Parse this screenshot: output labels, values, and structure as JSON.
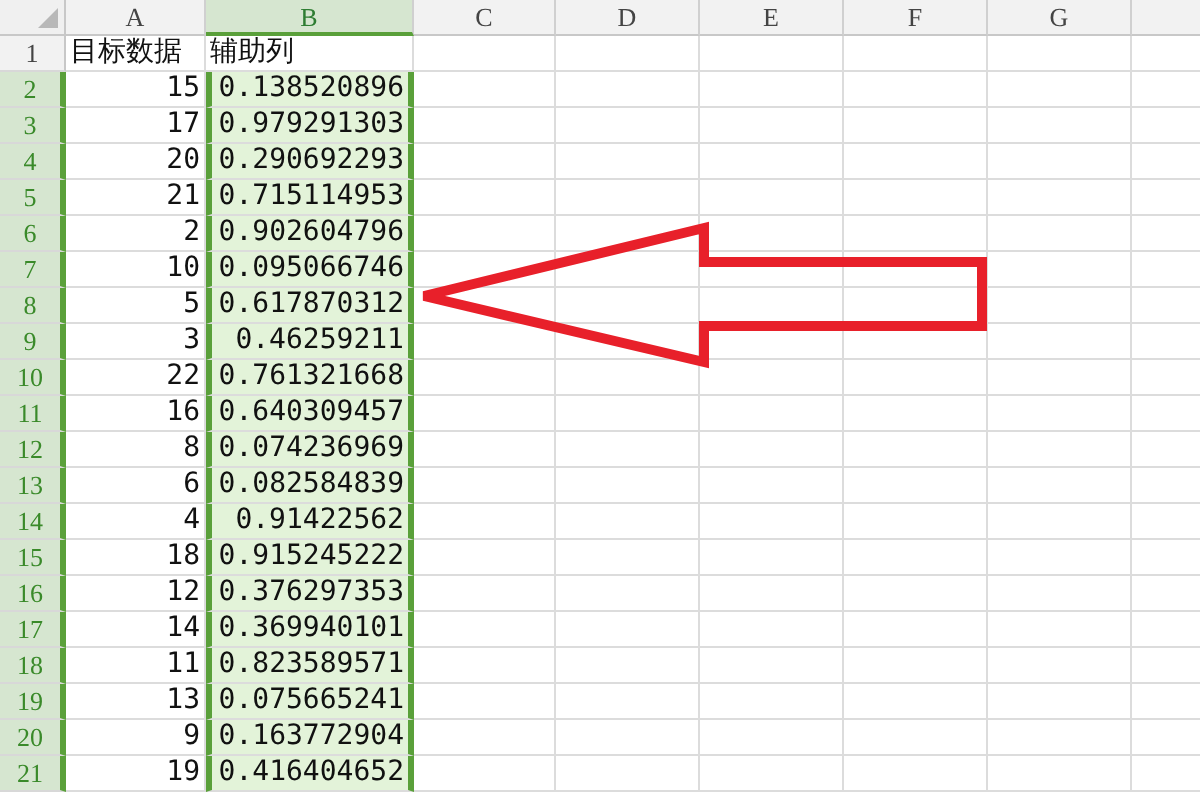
{
  "columns": [
    {
      "label": "A",
      "selected": false
    },
    {
      "label": "B",
      "selected": true
    },
    {
      "label": "C",
      "selected": false
    },
    {
      "label": "D",
      "selected": false
    },
    {
      "label": "E",
      "selected": false
    },
    {
      "label": "F",
      "selected": false
    },
    {
      "label": "G",
      "selected": false
    }
  ],
  "rows": [
    {
      "number": "1",
      "selected": false,
      "kind": "text",
      "cells": [
        "目标数据",
        "辅助列"
      ]
    },
    {
      "number": "2",
      "selected": true,
      "kind": "number",
      "cells": [
        "15",
        "0.138520896"
      ]
    },
    {
      "number": "3",
      "selected": true,
      "kind": "number",
      "cells": [
        "17",
        "0.979291303"
      ]
    },
    {
      "number": "4",
      "selected": true,
      "kind": "number",
      "cells": [
        "20",
        "0.290692293"
      ]
    },
    {
      "number": "5",
      "selected": true,
      "kind": "number",
      "cells": [
        "21",
        "0.715114953"
      ]
    },
    {
      "number": "6",
      "selected": true,
      "kind": "number",
      "cells": [
        "2",
        "0.902604796"
      ]
    },
    {
      "number": "7",
      "selected": true,
      "kind": "number",
      "cells": [
        "10",
        "0.095066746"
      ]
    },
    {
      "number": "8",
      "selected": true,
      "kind": "number",
      "cells": [
        "5",
        "0.617870312"
      ]
    },
    {
      "number": "9",
      "selected": true,
      "kind": "number",
      "cells": [
        "3",
        "0.46259211"
      ]
    },
    {
      "number": "10",
      "selected": true,
      "kind": "number",
      "cells": [
        "22",
        "0.761321668"
      ]
    },
    {
      "number": "11",
      "selected": true,
      "kind": "number",
      "cells": [
        "16",
        "0.640309457"
      ]
    },
    {
      "number": "12",
      "selected": true,
      "kind": "number",
      "cells": [
        "8",
        "0.074236969"
      ]
    },
    {
      "number": "13",
      "selected": true,
      "kind": "number",
      "cells": [
        "6",
        "0.082584839"
      ]
    },
    {
      "number": "14",
      "selected": true,
      "kind": "number",
      "cells": [
        "4",
        "0.91422562"
      ]
    },
    {
      "number": "15",
      "selected": true,
      "kind": "number",
      "cells": [
        "18",
        "0.915245222"
      ]
    },
    {
      "number": "16",
      "selected": true,
      "kind": "number",
      "cells": [
        "12",
        "0.376297353"
      ]
    },
    {
      "number": "17",
      "selected": true,
      "kind": "number",
      "cells": [
        "14",
        "0.369940101"
      ]
    },
    {
      "number": "18",
      "selected": true,
      "kind": "number",
      "cells": [
        "11",
        "0.823589571"
      ]
    },
    {
      "number": "19",
      "selected": true,
      "kind": "number",
      "cells": [
        "13",
        "0.075665241"
      ]
    },
    {
      "number": "20",
      "selected": true,
      "kind": "number",
      "cells": [
        "9",
        "0.163772904"
      ]
    },
    {
      "number": "21",
      "selected": true,
      "kind": "number",
      "cells": [
        "19",
        "0.416404652"
      ]
    }
  ]
}
